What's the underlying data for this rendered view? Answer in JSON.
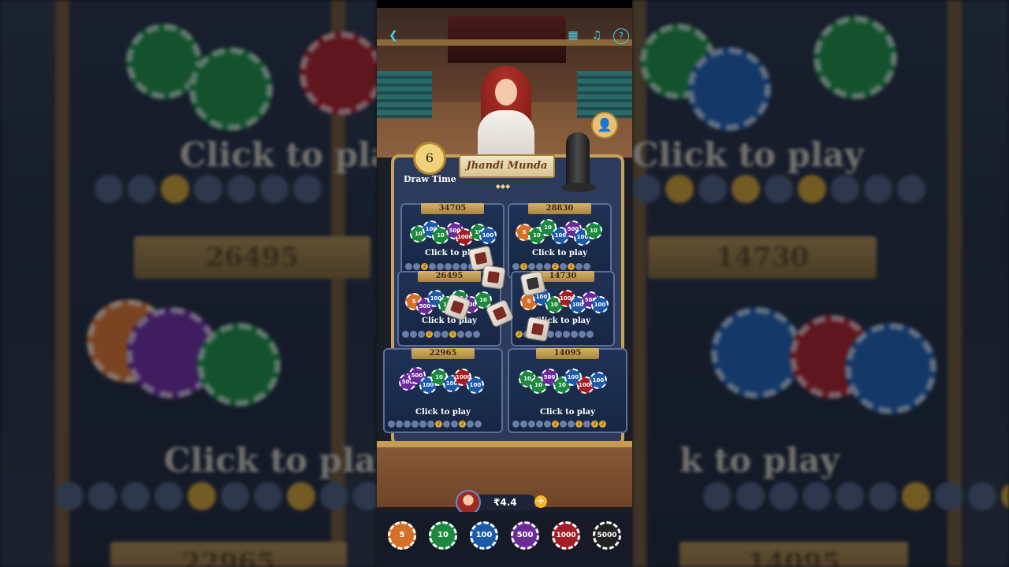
{
  "game": {
    "title": "Jhandi Munda",
    "draw_time_label": "Draw Time",
    "timer_value": "6",
    "bet_prompt": "Click to play",
    "balance": "₹4.4"
  },
  "cells": [
    {
      "amount": "34705",
      "label": "Click to play"
    },
    {
      "amount": "28830",
      "label": "Click to play"
    },
    {
      "amount": "26495",
      "label": "Click to play"
    },
    {
      "amount": "14730",
      "label": "Click to play"
    },
    {
      "amount": "22965",
      "label": "Click to play"
    },
    {
      "amount": "14095",
      "label": "Click to play"
    }
  ],
  "history_marker": "2",
  "history_marker_alt": "3",
  "chips": [
    {
      "value": "5",
      "color": "orange"
    },
    {
      "value": "10",
      "color": "green"
    },
    {
      "value": "100",
      "color": "blue"
    },
    {
      "value": "500",
      "color": "purple"
    },
    {
      "value": "1000",
      "color": "red"
    },
    {
      "value": "5000",
      "color": "black"
    }
  ],
  "background": {
    "left_amount": "26495",
    "right_amount": "14730",
    "left_bottom_amount": "22965",
    "right_bottom_amount": "14095",
    "left_text": "Click to play",
    "right_text": "Click to play",
    "left_text_bottom": "Click to play",
    "right_text_bottom": "k to play"
  },
  "colors": {
    "accent_gold": "#caa257",
    "board_blue": "#2c3a5c",
    "icon_cyan": "#4ad0ea"
  }
}
